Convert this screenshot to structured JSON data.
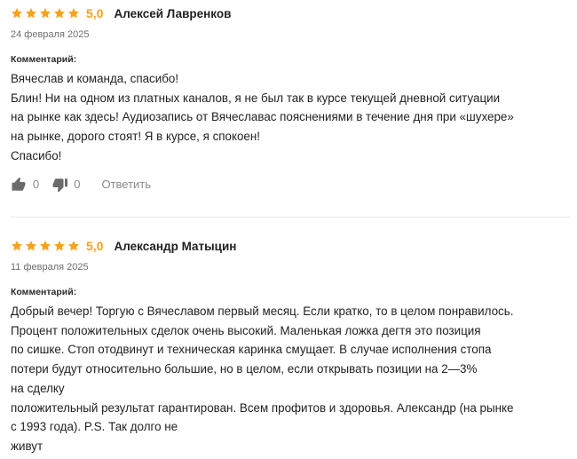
{
  "reviews": [
    {
      "rating": "5,0",
      "author": "Алексей Лавренков",
      "date": "24 февраля 2025",
      "comment_label": "Комментарий:",
      "lines": [
        "Вячеслав и команда, спасибо!",
        "Блин! Ни на одном из платных каналов, я не был так в курсе текущей дневной ситуации",
        "на рынке как здесь! Аудиозапись от Вячеславас пояснениями в течение дня при «шухере»",
        "на рынке, дорого стоят! Я в курсе, я спокоен!",
        "Спасибо!"
      ],
      "likes": "0",
      "dislikes": "0",
      "reply_label": "Ответить"
    },
    {
      "rating": "5,0",
      "author": "Александр Матыцин",
      "date": "11 февраля 2025",
      "comment_label": "Комментарий:",
      "lines": [
        "Добрый вечер! Торгую с Вячеславом первый месяц. Если кратко, то в целом понравилось.",
        "Процент положительных сделок очень высокий. Маленькая ложка дегтя это позиция",
        "по сишке. Стоп отодвинут и техническая каринка смущает. В случае исполнения стопа",
        "потери будут относительно большие, но в целом, если открывать позиции на 2—3%",
        "на сделку",
        "положительный результат гарантирован. Всем профитов и здоровья. Александр (на рынке",
        "с 1993 года). P.S. Так долго не",
        "живут"
      ]
    }
  ],
  "colors": {
    "star": "#f7a21b",
    "muted": "#8a8a8a",
    "divider": "#e6e6e6"
  },
  "icons": {
    "star": "star-icon",
    "like": "thumbs-up-icon",
    "dislike": "thumbs-down-icon"
  }
}
